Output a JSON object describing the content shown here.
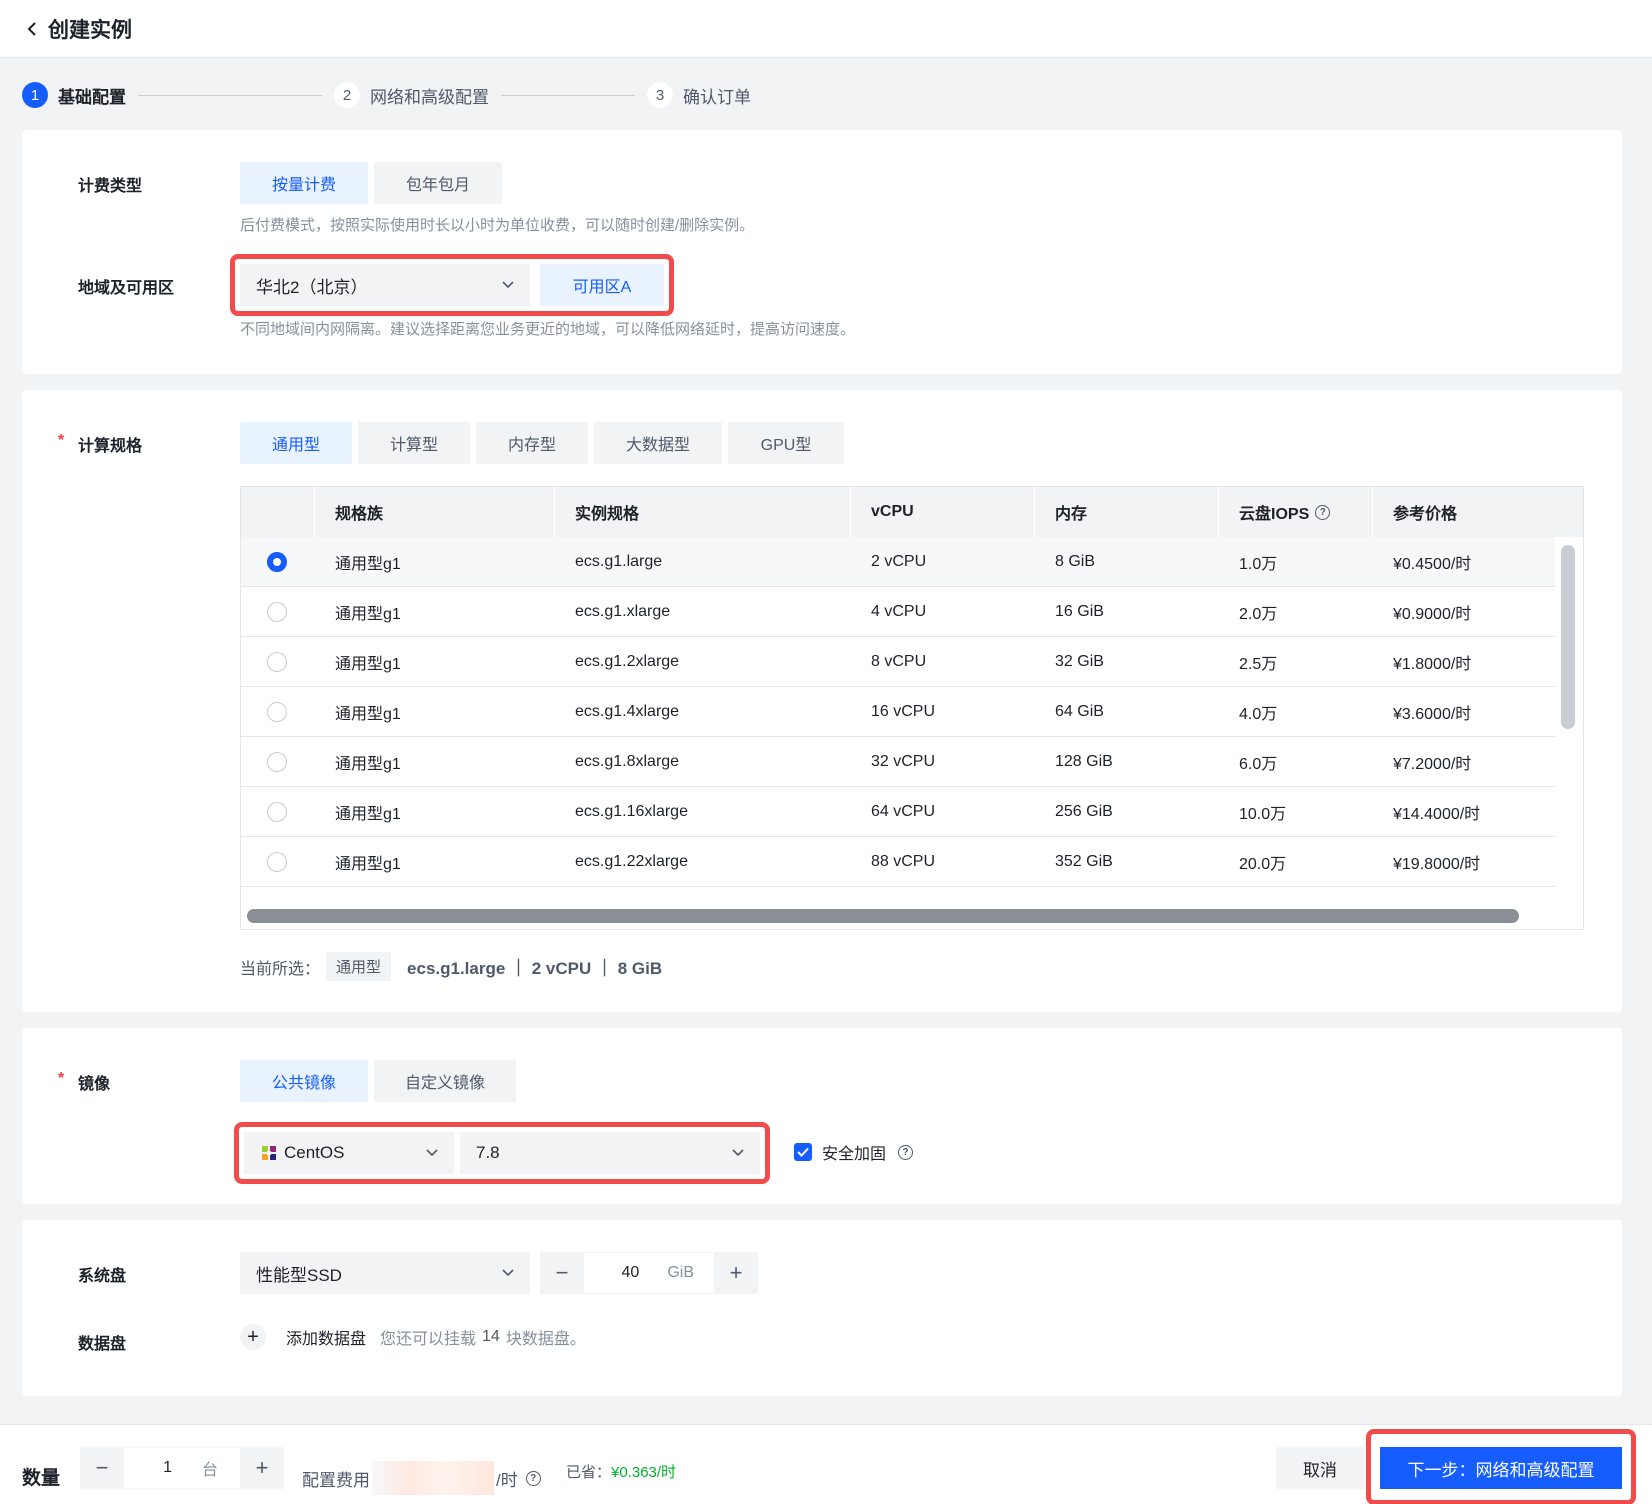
{
  "header": {
    "title": "创建实例"
  },
  "steps": [
    {
      "num": "1",
      "label": "基础配置"
    },
    {
      "num": "2",
      "label": "网络和高级配置"
    },
    {
      "num": "3",
      "label": "确认订单"
    }
  ],
  "billing": {
    "label": "计费类型",
    "options": [
      "按量计费",
      "包年包月"
    ],
    "selected": "按量计费",
    "hint": "后付费模式，按照实际使用时长以小时为单位收费，可以随时创建/删除实例。"
  },
  "region": {
    "label": "地域及可用区",
    "region_value": "华北2（北京）",
    "zone_value": "可用区A",
    "hint": "不同地域间内网隔离。建议选择距离您业务更近的地域，可以降低网络延时，提高访问速度。"
  },
  "spec": {
    "label": "计算规格",
    "tabs": [
      "通用型",
      "计算型",
      "内存型",
      "大数据型",
      "GPU型"
    ],
    "selected_tab": "通用型",
    "columns": [
      "规格族",
      "实例规格",
      "vCPU",
      "内存",
      "云盘IOPS",
      "参考价格"
    ],
    "rows": [
      {
        "family": "通用型g1",
        "type": "ecs.g1.large",
        "vcpu": "2 vCPU",
        "mem": "8 GiB",
        "iops": "1.0万",
        "price": "¥0.4500/时",
        "selected": true
      },
      {
        "family": "通用型g1",
        "type": "ecs.g1.xlarge",
        "vcpu": "4 vCPU",
        "mem": "16 GiB",
        "iops": "2.0万",
        "price": "¥0.9000/时",
        "selected": false
      },
      {
        "family": "通用型g1",
        "type": "ecs.g1.2xlarge",
        "vcpu": "8 vCPU",
        "mem": "32 GiB",
        "iops": "2.5万",
        "price": "¥1.8000/时",
        "selected": false
      },
      {
        "family": "通用型g1",
        "type": "ecs.g1.4xlarge",
        "vcpu": "16 vCPU",
        "mem": "64 GiB",
        "iops": "4.0万",
        "price": "¥3.6000/时",
        "selected": false
      },
      {
        "family": "通用型g1",
        "type": "ecs.g1.8xlarge",
        "vcpu": "32 vCPU",
        "mem": "128 GiB",
        "iops": "6.0万",
        "price": "¥7.2000/时",
        "selected": false
      },
      {
        "family": "通用型g1",
        "type": "ecs.g1.16xlarge",
        "vcpu": "64 vCPU",
        "mem": "256 GiB",
        "iops": "10.0万",
        "price": "¥14.4000/时",
        "selected": false
      },
      {
        "family": "通用型g1",
        "type": "ecs.g1.22xlarge",
        "vcpu": "88 vCPU",
        "mem": "352 GiB",
        "iops": "20.0万",
        "price": "¥19.8000/时",
        "selected": false
      }
    ],
    "current_label": "当前所选：",
    "current_tag": "通用型",
    "current_value": "ecs.g1.large ｜ 2 vCPU ｜ 8 GiB"
  },
  "image": {
    "label": "镜像",
    "tabs": [
      "公共镜像",
      "自定义镜像"
    ],
    "selected_tab": "公共镜像",
    "os_value": "CentOS",
    "version_value": "7.8",
    "security_label": "安全加固",
    "security_checked": true
  },
  "disk": {
    "system_label": "系统盘",
    "system_type": "性能型SSD",
    "system_size": "40",
    "system_unit": "GiB",
    "data_label": "数据盘",
    "add_label": "添加数据盘",
    "add_hint_prefix": "您还可以挂载",
    "add_hint_count": "14",
    "add_hint_suffix": "块数据盘。"
  },
  "footer": {
    "qty_label": "数量",
    "qty_value": "1",
    "qty_unit": "台",
    "fee_label": "配置费用",
    "fee_unit": "/时",
    "saved_label": "已省：",
    "saved_value": "¥0.363/时",
    "cancel_label": "取消",
    "next_label": "下一步：网络和高级配置"
  },
  "colors": {
    "primary": "#165dff",
    "danger": "#f53f3f",
    "success": "#00b42a",
    "highlight_box": "#f24b4b"
  }
}
